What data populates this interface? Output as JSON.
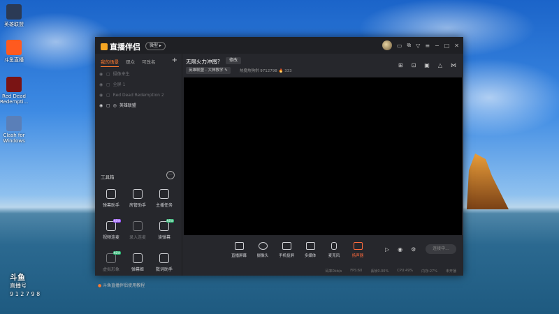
{
  "desktop": {
    "icons": [
      {
        "label": "英雄联盟",
        "icon": "lol-icon",
        "color": "#2b3a55"
      },
      {
        "label": "斗鱼直播",
        "icon": "streaming-app-icon",
        "color": "#ff5a1f"
      },
      {
        "label": "Red Dead Redempti...",
        "icon": "rdr2-icon",
        "color": "#7a1414"
      },
      {
        "label": "Clash for Windows",
        "icon": "cat-icon",
        "color": "#5a7fb8"
      }
    ],
    "watermark_line1": "斗鱼",
    "watermark_line2": "直播号",
    "watermark_line3": "9 1 2 7 9 8"
  },
  "window": {
    "app_name": "直播伴侣",
    "version_pill": "微型",
    "titlebar_icons": [
      "avatar",
      "chat-icon",
      "window-icon",
      "shirt-icon",
      "menu-icon",
      "minimize-icon",
      "maximize-icon",
      "close-icon"
    ]
  },
  "left": {
    "tabs": [
      "我的场景",
      "观众",
      "可改名"
    ],
    "scenes": [
      {
        "label": "摄像来生",
        "on": false
      },
      {
        "label": "全屏 1",
        "on": false
      },
      {
        "label": "Red Dead Redemption 2",
        "on": false
      },
      {
        "label": "英雄联盟",
        "on": true
      }
    ],
    "tools_title": "工具箱",
    "tools": [
      {
        "label": "弹幕助手",
        "icon": "danmaku-icon",
        "dim": false,
        "badge": ""
      },
      {
        "label": "房管助手",
        "icon": "admin-icon",
        "dim": false,
        "badge": ""
      },
      {
        "label": "主播任务",
        "icon": "task-icon",
        "dim": false,
        "badge": ""
      },
      {
        "label": "视频连麦",
        "icon": "video-link-icon",
        "dim": false,
        "badge": "NEW"
      },
      {
        "label": "录入连麦",
        "icon": "download-icon",
        "dim": true,
        "badge": ""
      },
      {
        "label": "读弹幕",
        "icon": "read-danmaku-icon",
        "dim": false,
        "badge": "NEW"
      },
      {
        "label": "虚拟形象",
        "icon": "avatar-tool-icon",
        "dim": true,
        "badge": "NEW"
      },
      {
        "label": "弹幕姬",
        "icon": "danmaku-box-icon",
        "dim": false,
        "badge": ""
      },
      {
        "label": "数词助手",
        "icon": "count-icon",
        "dim": false,
        "badge": ""
      }
    ],
    "footer": "斗鱼直播伴侣使用教程"
  },
  "main": {
    "room_title": "无限火力冲囤?",
    "edit_label": "修改",
    "category": "英雄联盟 - 大神教学",
    "stats": "热度热狗供   9712798   🔥 333",
    "room_icons": [
      "gift-icon",
      "lock-icon",
      "layout-icon",
      "bell-icon",
      "share-icon"
    ],
    "controls": [
      {
        "label": "直播屏幕",
        "icon": "screen-icon"
      },
      {
        "label": "摄像头",
        "icon": "camera-icon"
      },
      {
        "label": "手机投屏",
        "icon": "phone-icon"
      },
      {
        "label": "多媒体",
        "icon": "media-icon"
      },
      {
        "label": "麦克风",
        "icon": "mic-icon"
      },
      {
        "label": "扬声器",
        "icon": "speaker-icon"
      }
    ],
    "extra_icons": [
      "record-icon",
      "preview-eye-icon",
      "settings-icon"
    ],
    "live_button": "连接中...",
    "status": [
      "码率0kb/s",
      "FPS:60",
      "丢帧0.00%",
      "CPU:49%",
      "内存:27%",
      "未开播"
    ]
  }
}
